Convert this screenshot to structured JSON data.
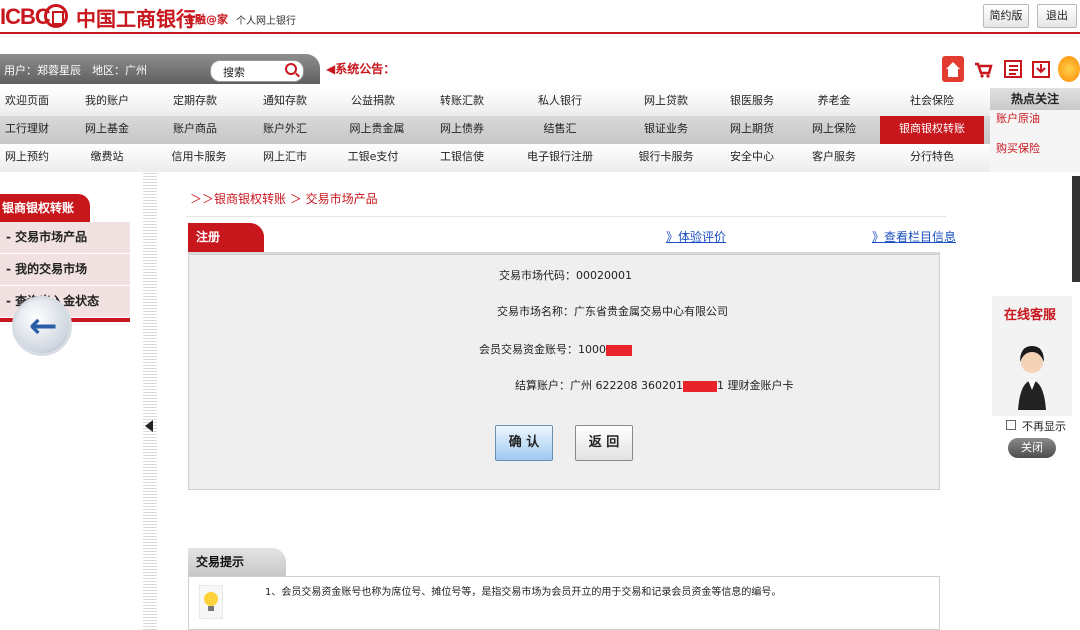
{
  "header": {
    "brand_en": "ICBC",
    "brand_cn": "中国工商银行",
    "slogan": "金融@家",
    "subtitle": "个人网上银行",
    "simple_btn": "简约版",
    "logout_btn": "退出"
  },
  "userbar": {
    "user_info": "用户：郑蓉星辰　地区：广州",
    "search_label": "搜索",
    "notice": "◀系统公告："
  },
  "nav": {
    "row0": [
      "欢迎页面",
      "我的账户",
      "定期存款",
      "通知存款",
      "公益捐款",
      "转账汇款",
      "私人银行",
      "网上贷款",
      "银医服务",
      "养老金",
      "社会保险"
    ],
    "row1": [
      "工行理财",
      "网上基金",
      "账户商品",
      "账户外汇",
      "网上贵金属",
      "网上债券",
      "结售汇",
      "银证业务",
      "网上期货",
      "网上保险",
      "银商银权转账"
    ],
    "row2": [
      "网上预约",
      "缴费站",
      "信用卡服务",
      "网上汇市",
      "工银e支付",
      "工银信使",
      "电子银行注册",
      "银行卡服务",
      "安全中心",
      "客户服务",
      "分行特色"
    ],
    "hot_title": "热点关注",
    "hot_links": [
      "账户原油",
      "购买保险"
    ]
  },
  "sidebar": {
    "title": "银商银权转账",
    "items": [
      "- 交易市场产品",
      "- 我的交易市场",
      "- 查询出入金状态"
    ]
  },
  "main": {
    "breadcrumb": "＞＞银商银权转账 ＞ 交易市场产品",
    "tab": "注册",
    "link_eval": "》体验评价",
    "link_info": "》查看栏目信息",
    "fields": {
      "code": "交易市场代码：00020001",
      "name": "交易市场名称：广东省贵金属交易中心有限公司",
      "acct_label": "会员交易资金账号：1000",
      "settle_label": "结算账户：广州 622208 360201",
      "settle_suffix": "1 理财金账户卡"
    },
    "confirm_btn": "确 认",
    "back_btn": "返 回"
  },
  "tip": {
    "title": "交易提示",
    "text": "1、会员交易资金账号也称为席位号、摊位号等，是指交易市场为会员开立的用于交易和记录会员资金等信息的编号。"
  },
  "widget": {
    "title": "在线客服",
    "checkbox_label": "不再显示",
    "close_btn": "关闭"
  },
  "colors": {
    "brand_red": "#c8161d",
    "link_blue": "#1a4fbf"
  }
}
